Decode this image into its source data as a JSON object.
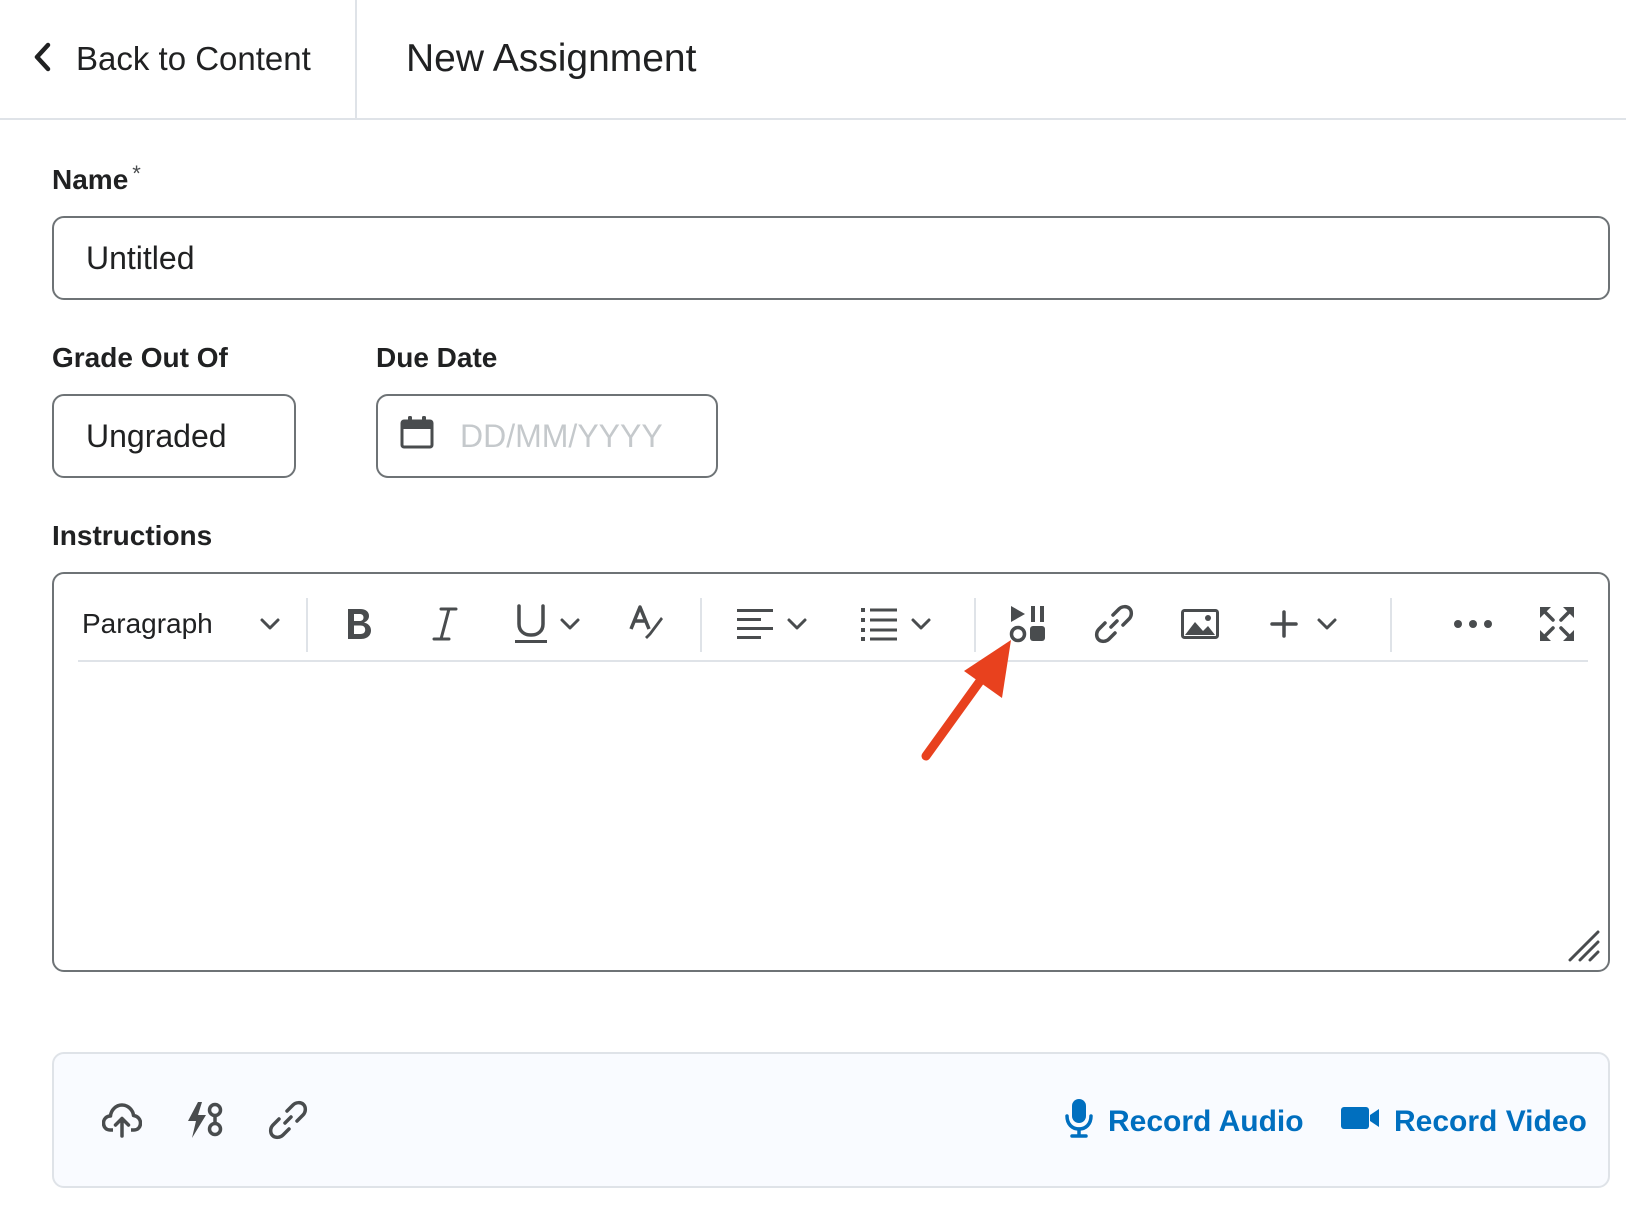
{
  "header": {
    "back_label": "Back to Content",
    "title": "New Assignment"
  },
  "form": {
    "name_label": "Name",
    "name_required_mark": "*",
    "name_value": "Untitled",
    "grade_label": "Grade Out Of",
    "grade_value": "Ungraded",
    "due_label": "Due Date",
    "due_placeholder": "DD/MM/YYYY",
    "instructions_label": "Instructions"
  },
  "editor": {
    "paragraph_label": "Paragraph",
    "icons": [
      "chevron-down-icon",
      "bold-icon",
      "italic-icon",
      "underline-icon",
      "format-painter-icon",
      "align-left-icon",
      "bullet-list-icon",
      "insert-stuff-icon",
      "link-icon",
      "image-icon",
      "plus-icon",
      "more-icon",
      "fullscreen-icon"
    ]
  },
  "attachments": {
    "record_audio_label": "Record Audio",
    "record_video_label": "Record Video",
    "icons": [
      "upload-icon",
      "quicklink-icon",
      "link-icon",
      "microphone-icon",
      "video-camera-icon"
    ]
  },
  "colors": {
    "accent": "#006fbf",
    "annotation_arrow": "#e8411e",
    "border": "#6e7376",
    "divider": "#dfe3e8"
  }
}
